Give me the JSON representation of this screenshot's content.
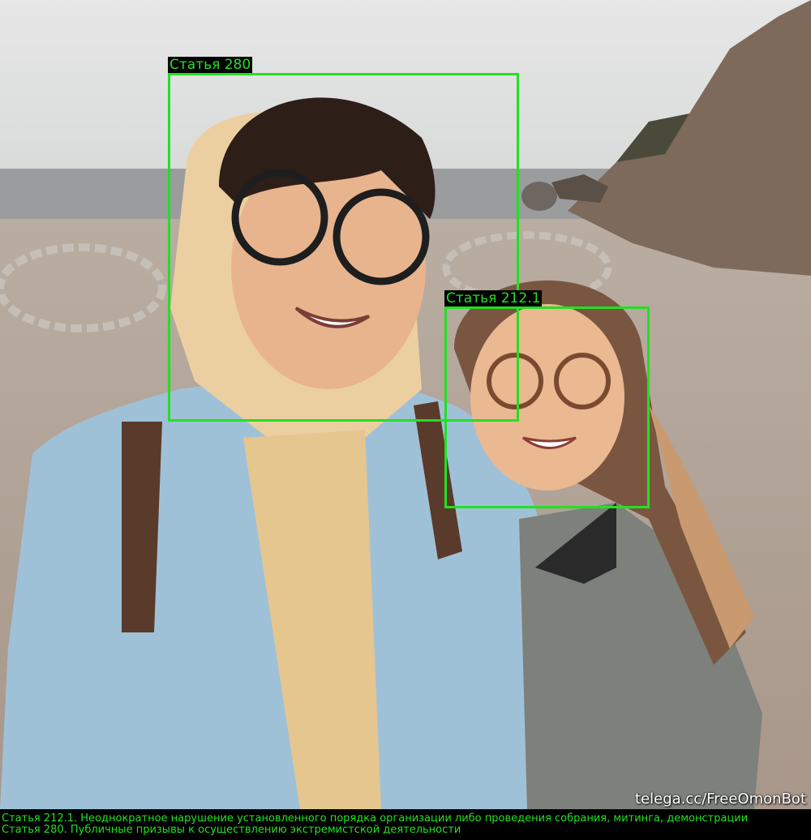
{
  "detections": [
    {
      "label": "Статья 280"
    },
    {
      "label": "Статья 212.1"
    }
  ],
  "watermark": "telega.cc/FreeOmonBot",
  "captions": [
    "Статья 212.1. Неоднократное нарушение установленного порядка организации либо проведения собрания, митинга, демонстрации",
    "Статья 280. Публичные призывы к осуществлению экстремистской деятельности"
  ],
  "colors": {
    "box": "#22e022",
    "caption_bg": "#000000"
  }
}
